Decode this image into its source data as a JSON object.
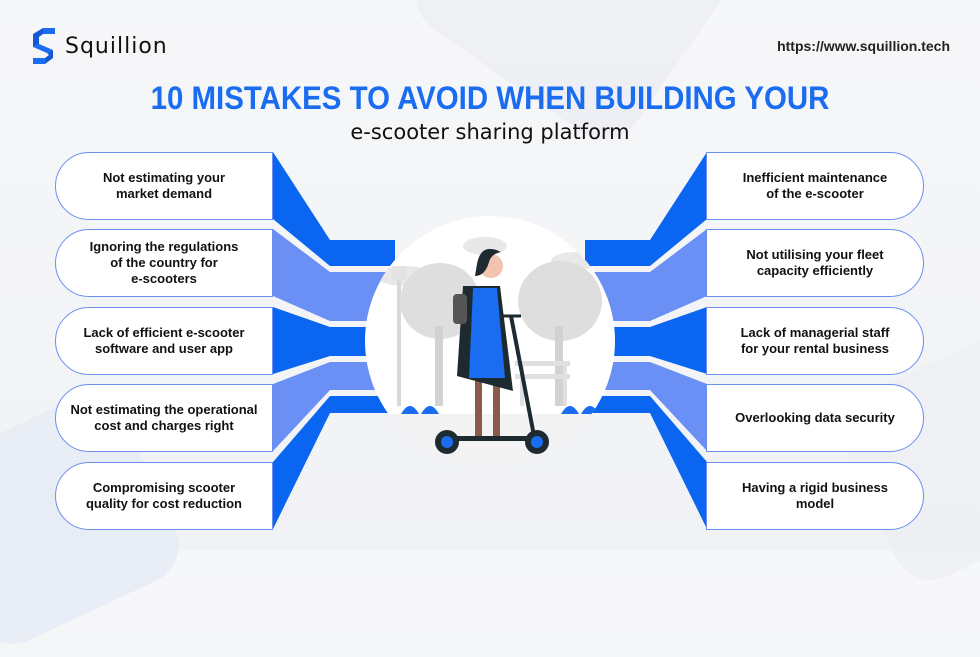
{
  "brand": {
    "name": "Squillion",
    "url": "https://www.squillion.tech"
  },
  "header": {
    "title": "10 MISTAKES TO AVOID WHEN BUILDING YOUR",
    "subtitle": "e-scooter sharing platform"
  },
  "colors": {
    "primary": "#0a66f0",
    "secondary": "#6a8ff5",
    "pill_border": "#6a8ff0"
  },
  "mistakes_left": [
    {
      "label": "Not estimating your\nmarket demand"
    },
    {
      "label": "Ignoring the regulations\nof the  country for\ne-scooters"
    },
    {
      "label": "Lack of efficient e-scooter\nsoftware and user app"
    },
    {
      "label": "Not estimating the operational\ncost and charges right"
    },
    {
      "label": "Compromising scooter\nquality for cost reduction"
    }
  ],
  "mistakes_right": [
    {
      "label": "Inefficient maintenance\nof the e-scooter"
    },
    {
      "label": "Not utilising your fleet\ncapacity efficiently"
    },
    {
      "label": "Lack of managerial staff\nfor your rental business"
    },
    {
      "label": "Overlooking data security"
    },
    {
      "label": "Having a rigid business\nmodel"
    }
  ],
  "illustration": {
    "subject": "woman-riding-e-scooter-in-park"
  }
}
